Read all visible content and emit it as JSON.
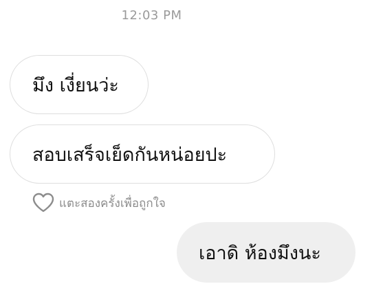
{
  "thread": {
    "timestamp": "12:03 PM",
    "messages": [
      {
        "direction": "incoming",
        "text": "มึง เงี่ยนว่ะ"
      },
      {
        "direction": "incoming",
        "text": "สอบเสร็จเย็ดกันหน่อยปะ"
      },
      {
        "direction": "outgoing",
        "text": "เอาดิ ห้องมึงนะ"
      }
    ],
    "like_hint": {
      "icon": "heart-outline-icon",
      "text": "แตะสองครั้งเพื่อถูกใจ"
    }
  },
  "colors": {
    "background": "#ffffff",
    "incoming_border": "#dedede",
    "outgoing_bubble": "#efefef",
    "timestamp_text": "#9a9a9a",
    "message_text": "#111111",
    "hint_text": "#8c8c8c"
  }
}
